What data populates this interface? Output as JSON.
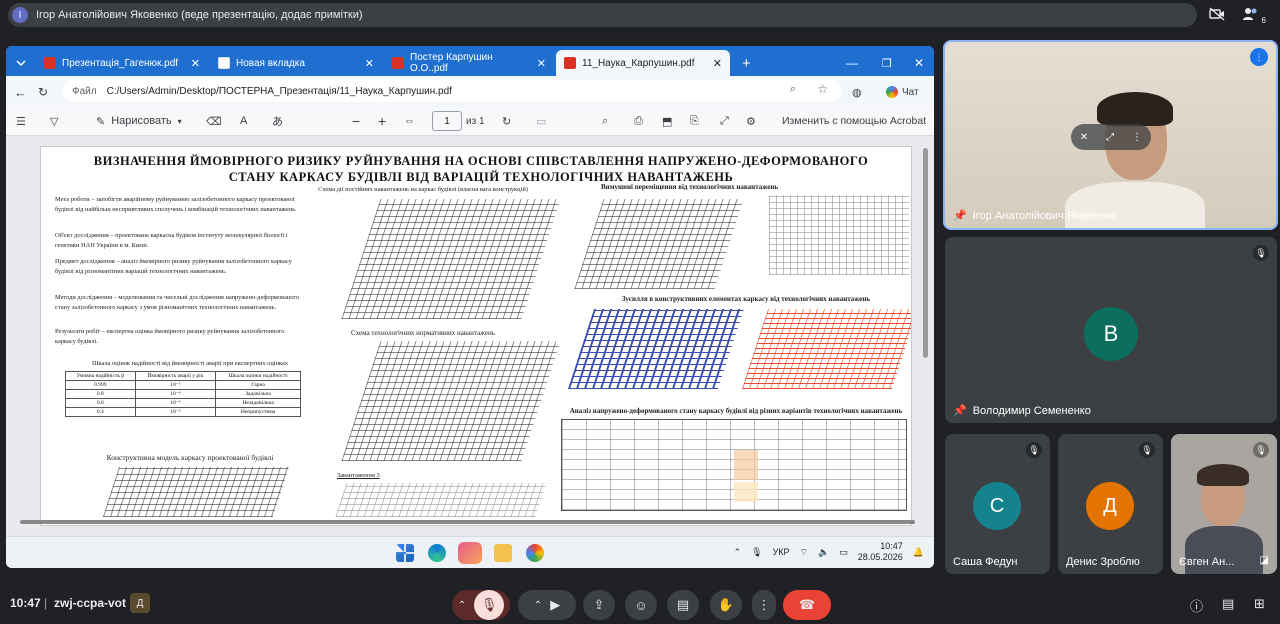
{
  "presenter_bar": {
    "avatar_letter": "І",
    "text": "Ігор Анатолійович Яковенко (веде презентацію, додає примітки)",
    "participant_count": "6"
  },
  "browser": {
    "tabs": [
      {
        "label": "Презентація_Гагенюк.pdf"
      },
      {
        "label": "Новая вкладка"
      },
      {
        "label": "Постер Карпушин О.О..pdf"
      },
      {
        "label": "11_Наука_Карпушин.pdf"
      }
    ],
    "address_prefix": "Файл",
    "address": "C:/Users/Admin/Desktop/ПОСТЕРНА_Презентація/11_Наука_Карпушин.pdf",
    "chat_label": "Чат"
  },
  "pdf_toolbar": {
    "draw_label": "Нарисовать",
    "page_value": "1",
    "page_total": "из 1",
    "edit_label": "Изменить с помощью Acrobat"
  },
  "poster": {
    "title": "ВИЗНАЧЕННЯ ЙМОВІРНОГО  РИЗИКУ РУЙНУВАННЯ НА ОСНОВІ СПІВСТАВЛЕННЯ НАПРУЖЕНО-ДЕФОРМОВАНОГО СТАНУ КАРКАСУ БУДІВЛІ ВІД ВАРІАЦІЙ ТЕХНОЛОГІЧНИХ НАВАНТАЖЕНЬ",
    "goal": "Мета роботи – запобігти аварійному руйнуванню залізобетонного каркасу проектованої будівлі від найбільш несприятливих сполучень і комбінацій технологічних навантажень.",
    "object": "Об'єкт дослідження – проектована каркасна будівля інституту молекулярної біології і генетики НАН України в м. Києві.",
    "subject": "Предмет дослідження – аналіз ймовірного ризику руйнування залізобетонного каркасу будівлі від різноманітних варіацій технологічних навантажень.",
    "methods": "Методи дослідження – моделювання та чисельні дослідження напружено-деформованого стану залізобетонного каркасу з умов різноманітних технологічних навантажень.",
    "results": "Результати робіт – експертна оцінка ймовірного ризику руйнування залізобетонного каркасу будівлі.",
    "scale_caption": "Шкала оцінок надійності від ймовірності аварії при експертних оцінках",
    "scale_headers": [
      "Умовна надійність β",
      "Ймовірність аварії у рік",
      "Шкала оцінки надійності"
    ],
    "scale_rows": [
      [
        "0.999",
        "10⁻⁵",
        "Гарна"
      ],
      [
        "0.8",
        "10⁻⁴",
        "Задовільна"
      ],
      [
        "0.6",
        "10⁻³",
        "Незадовільна"
      ],
      [
        "0.4",
        "10⁻²",
        "Неприпустима"
      ]
    ],
    "model_caption": "Конструктивна модель каркасу проектованої будівлі",
    "scheme1_caption": "Схема дії постійних навантажень на каркас будівлі (власна вага конструкцій)",
    "scheme2_caption": "Схема технологічних нормативних навантажень",
    "scheme3_caption": "Завантаження 3",
    "displacements_caption": "Вимушені переміщення від технологічних навантажень",
    "forces_caption": "Зусилля в конструктивних елементах каркасу від технологічних навантажень",
    "analysis_caption": "Аналіз напружено-деформованого стану каркасу будівлі від різних варіантів технологічних навантажень"
  },
  "taskbar": {
    "language": "УКР",
    "time": "10:47",
    "date": "28.05.2026"
  },
  "participants": [
    {
      "name": "Ігор Анатолійович Яковенко"
    },
    {
      "name": "Володимир Семененко",
      "letter": "В"
    },
    {
      "name": "Саша Федун",
      "letter": "С"
    },
    {
      "name": "Денис Зроблю",
      "letter": "Д"
    },
    {
      "name": "Євген Ан..."
    }
  ],
  "colors": {
    "avatar_v": "#0b6e5e",
    "avatar_s": "#14838e",
    "avatar_d": "#e37400",
    "end_call": "#ea4335",
    "tab_bar": "#1f6fd1"
  },
  "meeting": {
    "time": "10:47",
    "code": "zwj-ccpa-vot"
  }
}
